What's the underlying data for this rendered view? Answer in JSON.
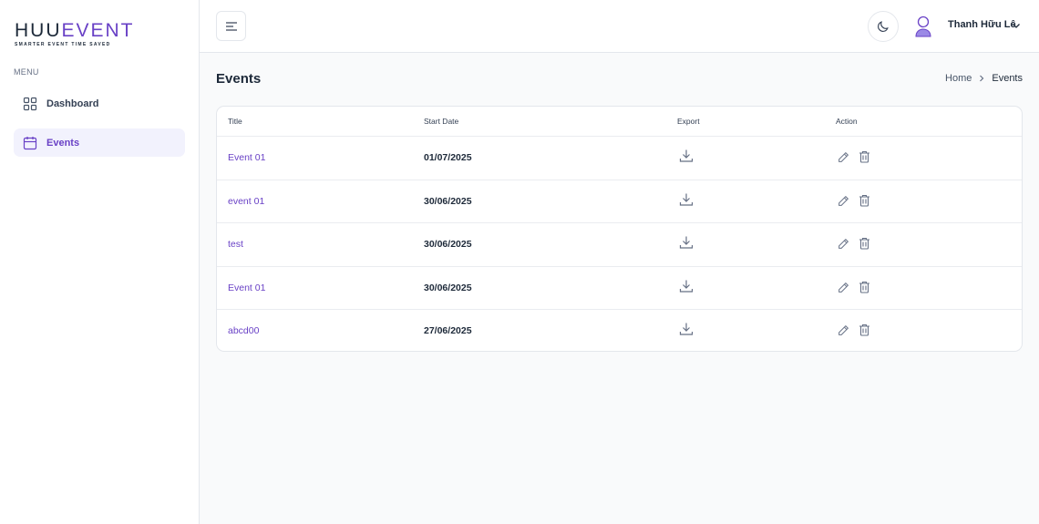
{
  "brand": {
    "logo_main": "HUU",
    "logo_accent": "EVENT",
    "tagline": "SMARTER EVENT TIME SAVED",
    "accent_color": "#6941c6"
  },
  "sidebar": {
    "menu_label": "MENU",
    "items": [
      {
        "label": "Dashboard",
        "icon": "grid-icon",
        "active": false
      },
      {
        "label": "Events",
        "icon": "calendar-icon",
        "active": true
      }
    ]
  },
  "header": {
    "user_name": "Thanh Hữu Lê"
  },
  "page": {
    "title": "Events",
    "breadcrumb": {
      "home": "Home",
      "current": "Events"
    }
  },
  "table": {
    "columns": [
      "Title",
      "Start Date",
      "Export",
      "Action"
    ],
    "rows": [
      {
        "title": "Event 01",
        "start_date": "01/07/2025"
      },
      {
        "title": "event 01",
        "start_date": "30/06/2025"
      },
      {
        "title": "test",
        "start_date": "30/06/2025"
      },
      {
        "title": "Event 01",
        "start_date": "30/06/2025"
      },
      {
        "title": "abcd00",
        "start_date": "27/06/2025"
      }
    ]
  }
}
